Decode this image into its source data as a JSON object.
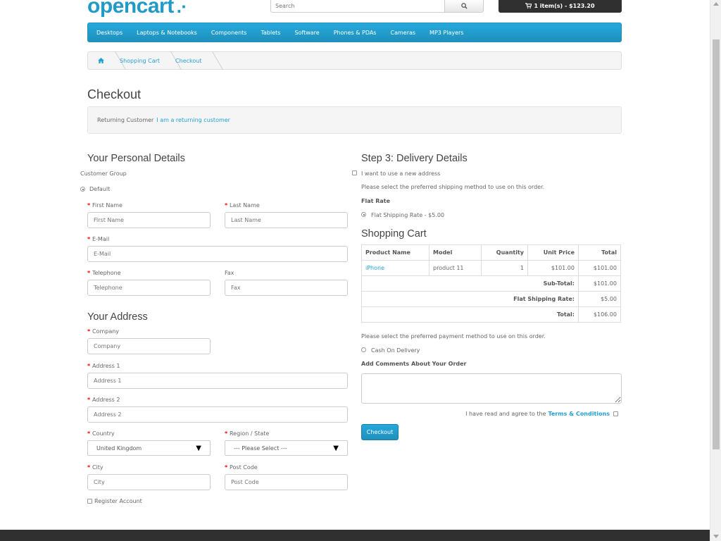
{
  "header": {
    "logo_text": "opencart",
    "logo_mark": ".·",
    "search_placeholder": "Search",
    "cart_label": "1 item(s) - $123.20"
  },
  "menu": [
    "Desktops",
    "Laptops & Notebooks",
    "Components",
    "Tablets",
    "Software",
    "Phones & PDAs",
    "Cameras",
    "MP3 Players"
  ],
  "breadcrumb": [
    "Shopping Cart",
    "Checkout"
  ],
  "page_title": "Checkout",
  "returning": {
    "label": "Returning Customer",
    "link": "I am a returning customer"
  },
  "personal": {
    "heading": "Your Personal Details",
    "customer_group_label": "Customer Group",
    "customer_group_option": "Default",
    "first_name_label": "First Name",
    "first_name_placeholder": "First Name",
    "last_name_label": "Last Name",
    "last_name_placeholder": "Last Name",
    "email_label": "E-Mail",
    "email_placeholder": "E-Mail",
    "telephone_label": "Telephone",
    "telephone_placeholder": "Telephone",
    "fax_label": "Fax",
    "fax_placeholder": "Fax"
  },
  "address": {
    "heading": "Your Address",
    "company_label": "Company",
    "company_placeholder": "Company",
    "address1_label": "Address 1",
    "address1_placeholder": "Address 1",
    "address2_label": "Address 2",
    "address2_placeholder": "Address 2",
    "country_label": "Country",
    "country_value": "United Kingdom",
    "region_label": "Region / State",
    "region_value": " --- Please Select --- ",
    "city_label": "City",
    "city_placeholder": "City",
    "postcode_label": "Post Code",
    "postcode_placeholder": "Post Code",
    "register_label": "Register Account"
  },
  "delivery": {
    "heading": "Step 3: Delivery Details",
    "new_address_label": "I want to use a new address",
    "shipping_prompt": "Please select the preferred shipping method to use on this order.",
    "flat_rate_heading": "Flat Rate",
    "flat_rate_option": "Flat Shipping Rate - $5.00"
  },
  "cart": {
    "heading": "Shopping Cart",
    "columns": [
      "Product Name",
      "Model",
      "Quantity",
      "Unit Price",
      "Total"
    ],
    "rows": [
      {
        "name": "iPhone",
        "model": "product 11",
        "quantity": "1",
        "unit_price": "$101.00",
        "total": "$101.00"
      }
    ],
    "totals": [
      {
        "label": "Sub-Total:",
        "value": "$101.00"
      },
      {
        "label": "Flat Shipping Rate:",
        "value": "$5.00"
      },
      {
        "label": "Total:",
        "value": "$106.00"
      }
    ]
  },
  "payment": {
    "prompt": "Please select the preferred payment method to use on this order.",
    "cod_option": "Cash On Delivery",
    "comments_label": "Add Comments About Your Order",
    "agree_text": "I have read and agree to the",
    "terms_link": "Terms & Conditions",
    "checkout_button": "Checkout"
  },
  "colors": {
    "brand": "#229ac8",
    "menu": "#1f90bb",
    "required": "#ff0000",
    "footer": "#303030"
  }
}
